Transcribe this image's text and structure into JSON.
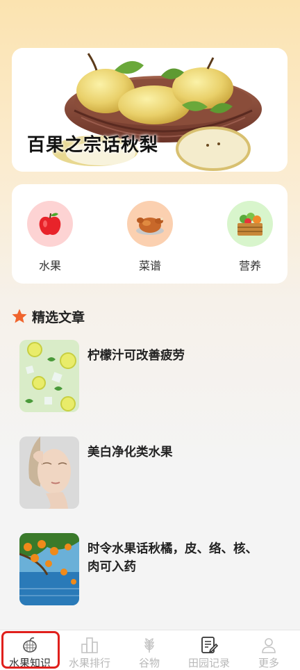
{
  "banner": {
    "title": "百果之宗话秋梨"
  },
  "categories": [
    {
      "label": "水果",
      "icon": "apple-icon",
      "bg": "#fdd3d3"
    },
    {
      "label": "菜谱",
      "icon": "roast-chicken-icon",
      "bg": "#fbd0b0"
    },
    {
      "label": "营养",
      "icon": "vegetable-basket-icon",
      "bg": "#d8f5cc"
    }
  ],
  "section": {
    "title": "精选文章",
    "icon": "star-icon",
    "icon_color": "#f0642d"
  },
  "articles": [
    {
      "title": "柠檬汁可改善疲劳",
      "thumb": "lemon-water-image"
    },
    {
      "title": "美白净化类水果",
      "thumb": "woman-face-image"
    },
    {
      "title": "时令水果话秋橘，皮、络、核、肉可入药",
      "thumb": "orange-tree-image"
    }
  ],
  "nav": {
    "items": [
      {
        "label": "水果知识",
        "icon": "fruit-icon",
        "active": true
      },
      {
        "label": "水果排行",
        "icon": "bar-chart-icon",
        "active": false
      },
      {
        "label": "谷物",
        "icon": "wheat-icon",
        "active": false
      },
      {
        "label": "田园记录",
        "icon": "note-edit-icon",
        "active": false
      },
      {
        "label": "更多",
        "icon": "user-icon",
        "active": false
      }
    ],
    "active_color": "#333333",
    "inactive_color": "#b8b8b8",
    "highlight_color": "#e0201c"
  }
}
